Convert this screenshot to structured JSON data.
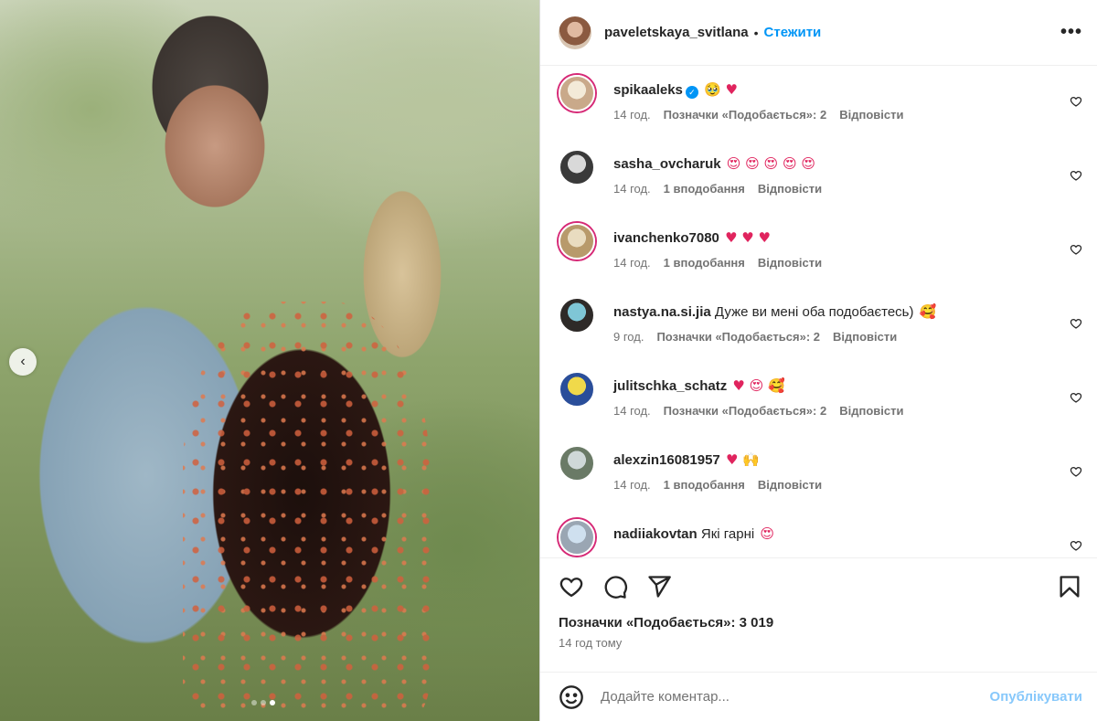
{
  "post": {
    "username": "paveletskaya_svitlana",
    "separator": "•",
    "follow_label": "Стежити",
    "more_label": "•••"
  },
  "photo": {
    "prev_arrow": "‹",
    "carousel_count": 3,
    "carousel_active": 3
  },
  "comments": [
    {
      "user": "spikaaleks",
      "verified": true,
      "text": "",
      "emoji": "🥹 ♥",
      "time": "14 год.",
      "likes": "Позначки «Подобається»: 2",
      "reply": "Відповісти",
      "avatar_colors": [
        "#f3ead8",
        "#c9a98a"
      ]
    },
    {
      "user": "sasha_ovcharuk",
      "verified": false,
      "text": "",
      "emoji": "😍 😍 😍 😍 😍",
      "time": "14 год.",
      "likes": "1 вподобання",
      "reply": "Відповісти",
      "avatar_colors": [
        "#d9d9d9",
        "#3a3a3a"
      ]
    },
    {
      "user": "ivanchenko7080",
      "verified": false,
      "text": "",
      "emoji": "♥ ♥ ♥",
      "time": "14 год.",
      "likes": "1 вподобання",
      "reply": "Відповісти",
      "avatar_colors": [
        "#e9dcc0",
        "#b89a6b"
      ]
    },
    {
      "user": "nastya.na.si.jia",
      "verified": false,
      "text": "Дуже ви мені оба подобаєтесь)",
      "emoji": "🥰",
      "time": "9 год.",
      "likes": "Позначки «Подобається»: 2",
      "reply": "Відповісти",
      "avatar_colors": [
        "#7fc6d6",
        "#2e2a28"
      ]
    },
    {
      "user": "julitschka_schatz",
      "verified": false,
      "text": "",
      "emoji": "♥ 😍 🥰",
      "time": "14 год.",
      "likes": "Позначки «Подобається»: 2",
      "reply": "Відповісти",
      "avatar_colors": [
        "#f0d94a",
        "#2a4e9a"
      ]
    },
    {
      "user": "alexzin16081957",
      "verified": false,
      "text": "",
      "emoji": "♥ 🙌",
      "time": "14 год.",
      "likes": "1 вподобання",
      "reply": "Відповісти",
      "avatar_colors": [
        "#cfd8d8",
        "#6a7a66"
      ]
    },
    {
      "user": "nadiiakovtan",
      "verified": false,
      "text": "Які гарні",
      "emoji": "😍",
      "time": "",
      "likes": "",
      "reply": "",
      "avatar_colors": [
        "#cfe0ef",
        "#9aa6b3"
      ]
    }
  ],
  "actions": {
    "like_icon": "heart-outline",
    "comment_icon": "speech-bubble",
    "share_icon": "paper-plane",
    "save_icon": "bookmark"
  },
  "stats": {
    "likes": "Позначки «Подобається»: 3 019",
    "posted": "14 год тому"
  },
  "composer": {
    "placeholder": "Додайте коментар...",
    "publish_label": "Опублікувати"
  }
}
